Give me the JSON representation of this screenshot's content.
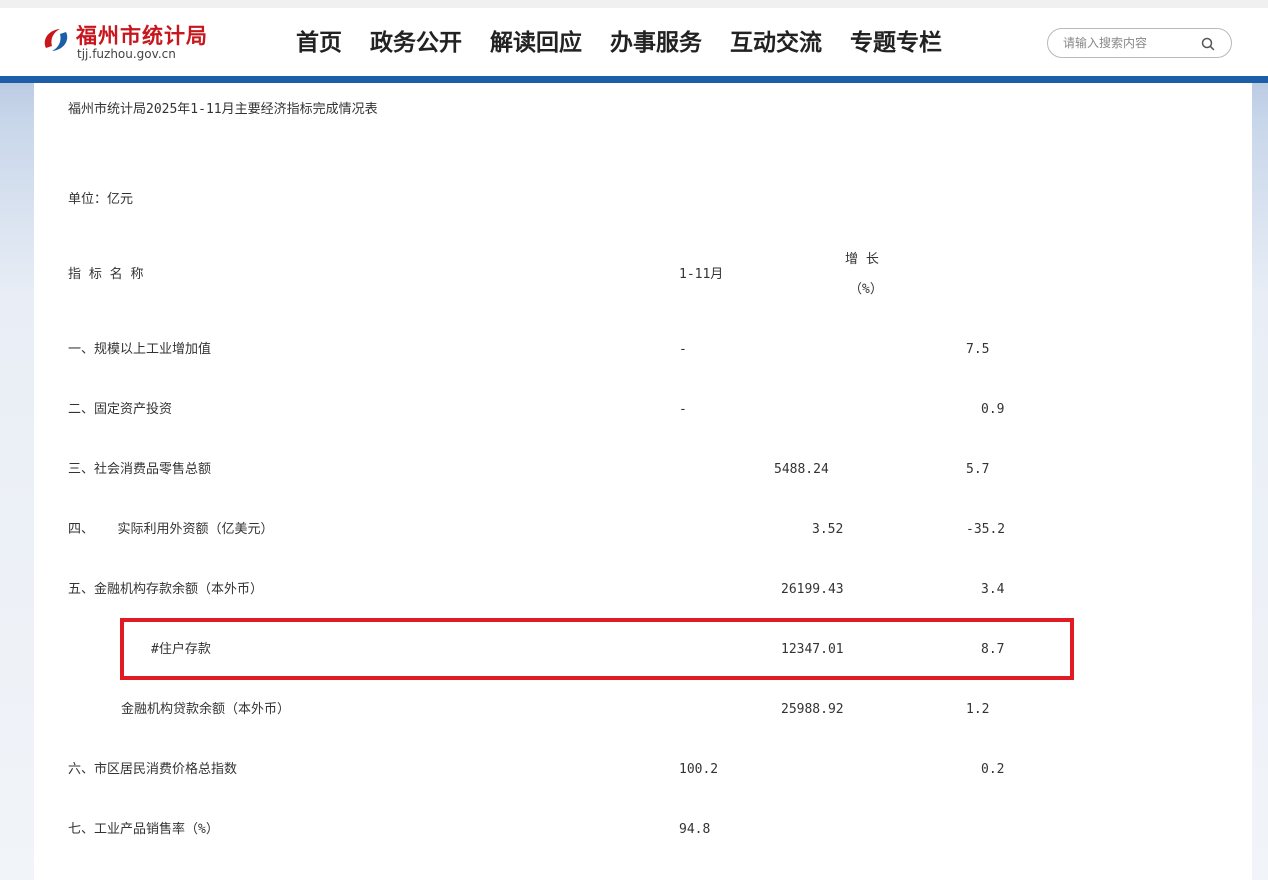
{
  "header": {
    "logo_cn": "福州市统计局",
    "logo_en": "tjj.fuzhou.gov.cn",
    "nav": [
      "首页",
      "政务公开",
      "解读回应",
      "办事服务",
      "互动交流",
      "专题专栏"
    ],
    "search_placeholder": "请输入搜索内容"
  },
  "doc": {
    "title": "福州市统计局2025年1-11月主要经济指标完成情况表",
    "unit": "单位：亿元",
    "col_name": "指 标 名 称",
    "col_period": "1-11月",
    "col_growth_1": "增 长",
    "col_growth_2": "（%）",
    "rows": [
      {
        "name": "一、规模以上工业增加值",
        "value": "-",
        "growth": "7.5"
      },
      {
        "name": "二、固定资产投资",
        "value": "-",
        "growth": "0.9"
      },
      {
        "name": "三、社会消费品零售总额",
        "value": "5488.24",
        "growth": "5.7"
      },
      {
        "name": "四、   实际利用外资额（亿美元）",
        "value": "3.52",
        "growth": "-35.2"
      },
      {
        "name": "五、金融机构存款余额（本外币）",
        "value": "26199.43",
        "growth": "3.4"
      },
      {
        "name": "#住户存款",
        "value": "12347.01",
        "growth": "8.7"
      },
      {
        "name": "金融机构贷款余额（本外币）",
        "value": "25988.92",
        "growth": "1.2"
      },
      {
        "name": "六、市区居民消费价格总指数",
        "value": "100.2",
        "growth": "0.2"
      },
      {
        "name": "七、工业产品销售率（%）",
        "value": "94.8",
        "growth": ""
      }
    ]
  },
  "colors": {
    "brand_red": "#c8161d",
    "header_blue": "#1d5ea8",
    "highlight_red": "#e01b23"
  }
}
